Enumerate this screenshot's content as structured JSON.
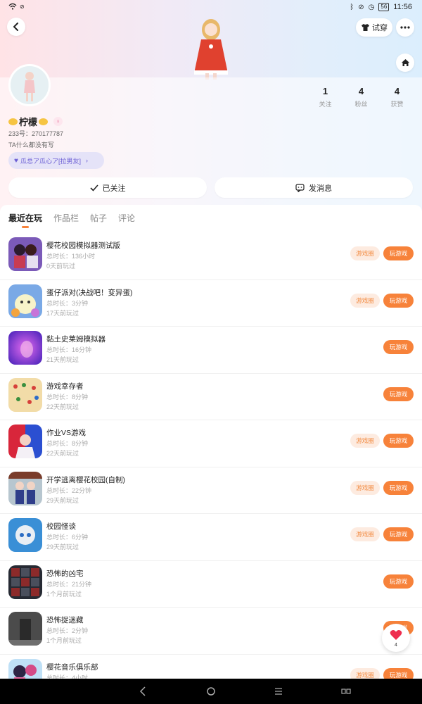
{
  "status_bar": {
    "time": "11:56",
    "battery": "56"
  },
  "header": {
    "try_label": "试穿"
  },
  "profile": {
    "nickname": "柠檬",
    "gender": "♀",
    "uid": "233号：270177787",
    "bio": "TA什么都没有写",
    "group_chip": "瓜总ア瓜心ア[拉男友]"
  },
  "stats": [
    {
      "value": "1",
      "label": "关注"
    },
    {
      "value": "4",
      "label": "粉丝"
    },
    {
      "value": "4",
      "label": "获赞"
    }
  ],
  "actions": {
    "follow_label": "已关注",
    "message_label": "发消息"
  },
  "tabs": [
    {
      "label": "最近在玩",
      "active": true
    },
    {
      "label": "作品栏",
      "active": false
    },
    {
      "label": "帖子",
      "active": false
    },
    {
      "label": "评论",
      "active": false
    }
  ],
  "games": [
    {
      "title": "樱花校园模拟器测试版",
      "duration": "总时长：136小时",
      "last": "0天前玩过",
      "circle": "游戏圈",
      "play": "玩游戏"
    },
    {
      "title": "蛋仔派对(决战吧！变异蛋)",
      "duration": "总时长：3分钟",
      "last": "17天前玩过",
      "circle": "游戏圈",
      "play": "玩游戏"
    },
    {
      "title": "黏土史莱姆模拟器",
      "duration": "总时长：16分钟",
      "last": "21天前玩过",
      "circle": "",
      "play": "玩游戏"
    },
    {
      "title": "游戏幸存者",
      "duration": "总时长：8分钟",
      "last": "22天前玩过",
      "circle": "",
      "play": "玩游戏"
    },
    {
      "title": "作业VS游戏",
      "duration": "总时长：8分钟",
      "last": "22天前玩过",
      "circle": "游戏圈",
      "play": "玩游戏"
    },
    {
      "title": "开学逃离樱花校园(自制)",
      "duration": "总时长：22分钟",
      "last": "29天前玩过",
      "circle": "游戏圈",
      "play": "玩游戏"
    },
    {
      "title": "校园怪谈",
      "duration": "总时长：6分钟",
      "last": "29天前玩过",
      "circle": "游戏圈",
      "play": "玩游戏"
    },
    {
      "title": "恐怖的凶宅",
      "duration": "总时长：21分钟",
      "last": "1个月前玩过",
      "circle": "",
      "play": "玩游戏"
    },
    {
      "title": "恐怖捉迷藏",
      "duration": "总时长：2分钟",
      "last": "1个月前玩过",
      "circle": "",
      "play": "玩游戏"
    },
    {
      "title": "樱花音乐俱乐部",
      "duration": "总时长：4小时",
      "last": "",
      "circle": "游戏圈",
      "play": "玩游戏"
    }
  ],
  "float_like": {
    "count": "4"
  },
  "colors": {
    "accent": "#f7823a",
    "accent_soft": "#fdebe0",
    "chip": "#e5e3f8"
  }
}
